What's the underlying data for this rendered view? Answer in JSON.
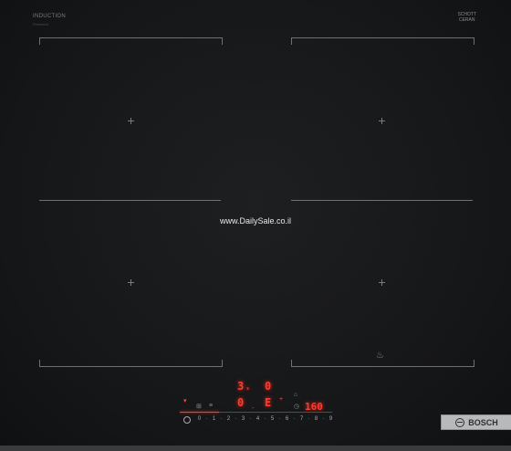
{
  "cooktop": {
    "top_left_label": "INDUCTION",
    "top_left_sub": "Preselect",
    "top_right_label_1": "SCHOTT",
    "top_right_label_2": "CERAN",
    "watermark": "www.DailySale.co.il",
    "brand": "BOSCH",
    "power_symbol": "⏻",
    "display": {
      "row1_left": "3",
      "row1_left_small": "s",
      "row1_right": "0",
      "row2_left": "0",
      "row2_right": "E",
      "timer": "160"
    },
    "scale": [
      "0",
      "1",
      "2",
      "3",
      "4",
      "5",
      "6",
      "7",
      "8",
      "9"
    ],
    "scale_display": [
      "0",
      "·",
      "1",
      "·",
      "2",
      "·",
      "3",
      "·",
      "4",
      "·",
      "5",
      "·",
      "6",
      "·",
      "7",
      "·",
      "8",
      "·",
      "9"
    ],
    "icons": [
      "pot-icon",
      "fire-icon",
      "clock-icon",
      "lock-icon",
      "plus-icon",
      "minus-icon"
    ]
  }
}
